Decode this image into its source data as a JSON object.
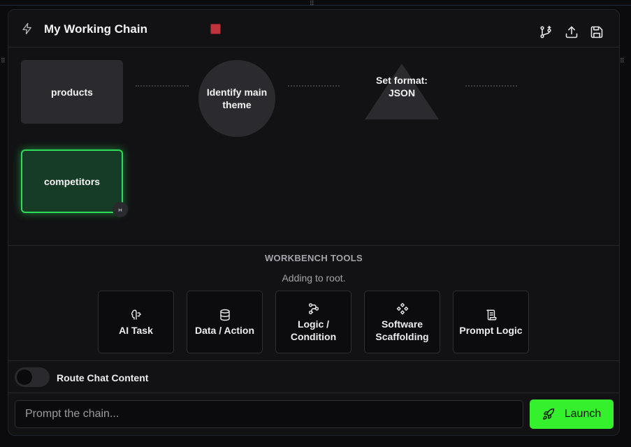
{
  "header": {
    "title": "My Working Chain",
    "icons": {
      "lead": "bolt-icon",
      "branch": "git-branch-plus-icon",
      "export": "upload-icon",
      "save": "save-icon"
    },
    "stop_color": "#c0333a"
  },
  "canvas": {
    "nodes": [
      {
        "label": "products",
        "shape": "rectangle"
      },
      {
        "label": "Identify main theme",
        "shape": "circle"
      },
      {
        "label": "Set format: JSON",
        "shape": "triangle"
      },
      {
        "label": "competitors",
        "shape": "rectangle",
        "selected": true
      }
    ],
    "collapse_glyph": "›‹"
  },
  "tools": {
    "title": "WORKBENCH TOOLS",
    "subtitle": "Adding to root.",
    "items": [
      {
        "label": "AI Task",
        "icon": "brain-icon"
      },
      {
        "label": "Data / Action",
        "icon": "database-icon"
      },
      {
        "label": "Logic / Condition",
        "icon": "workflow-icon"
      },
      {
        "label": "Software Scaffolding",
        "icon": "components-icon"
      },
      {
        "label": "Prompt Logic",
        "icon": "scroll-icon"
      }
    ]
  },
  "route": {
    "label": "Route Chat Content",
    "enabled": false
  },
  "prompt": {
    "placeholder": "Prompt the chain...",
    "value": ""
  },
  "launch": {
    "label": "Launch",
    "icon": "rocket-icon"
  },
  "colors": {
    "accent": "#35f12d",
    "selected_fill": "#173c26",
    "selected_border": "#2fdc5a",
    "panel": "#121214"
  }
}
